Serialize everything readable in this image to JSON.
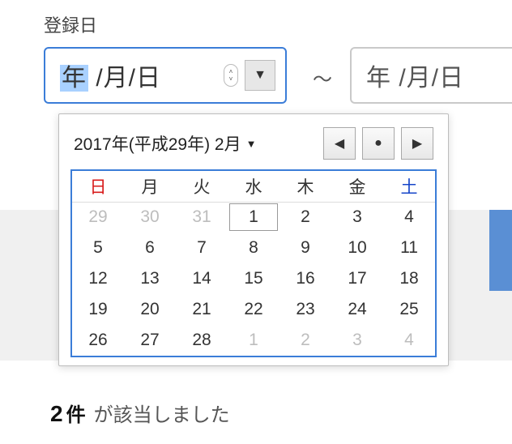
{
  "field_label": "登録日",
  "date_from": {
    "placeholder_year": "年",
    "placeholder_sep1": " /",
    "placeholder_month": "月",
    "placeholder_sep2": "/",
    "placeholder_day": "日"
  },
  "range_separator": "〜",
  "date_to": {
    "placeholder": "年 /月/日"
  },
  "calendar": {
    "title": "2017年(平成29年) 2月",
    "weekdays": [
      "日",
      "月",
      "火",
      "水",
      "木",
      "金",
      "土"
    ],
    "weeks": [
      [
        {
          "d": "29",
          "other": true
        },
        {
          "d": "30",
          "other": true
        },
        {
          "d": "31",
          "other": true
        },
        {
          "d": "1",
          "today": true
        },
        {
          "d": "2"
        },
        {
          "d": "3"
        },
        {
          "d": "4"
        }
      ],
      [
        {
          "d": "5"
        },
        {
          "d": "6"
        },
        {
          "d": "7"
        },
        {
          "d": "8"
        },
        {
          "d": "9"
        },
        {
          "d": "10"
        },
        {
          "d": "11"
        }
      ],
      [
        {
          "d": "12"
        },
        {
          "d": "13"
        },
        {
          "d": "14"
        },
        {
          "d": "15"
        },
        {
          "d": "16"
        },
        {
          "d": "17"
        },
        {
          "d": "18"
        }
      ],
      [
        {
          "d": "19"
        },
        {
          "d": "20"
        },
        {
          "d": "21"
        },
        {
          "d": "22"
        },
        {
          "d": "23"
        },
        {
          "d": "24"
        },
        {
          "d": "25"
        }
      ],
      [
        {
          "d": "26"
        },
        {
          "d": "27"
        },
        {
          "d": "28"
        },
        {
          "d": "1",
          "other": true
        },
        {
          "d": "2",
          "other": true
        },
        {
          "d": "3",
          "other": true
        },
        {
          "d": "4",
          "other": true
        }
      ]
    ],
    "nav": {
      "prev": "◀",
      "today": "●",
      "next": "▶"
    },
    "dropdown_arrow": "▼"
  },
  "results": {
    "count": "2",
    "unit": "件",
    "text": "が該当しました"
  }
}
